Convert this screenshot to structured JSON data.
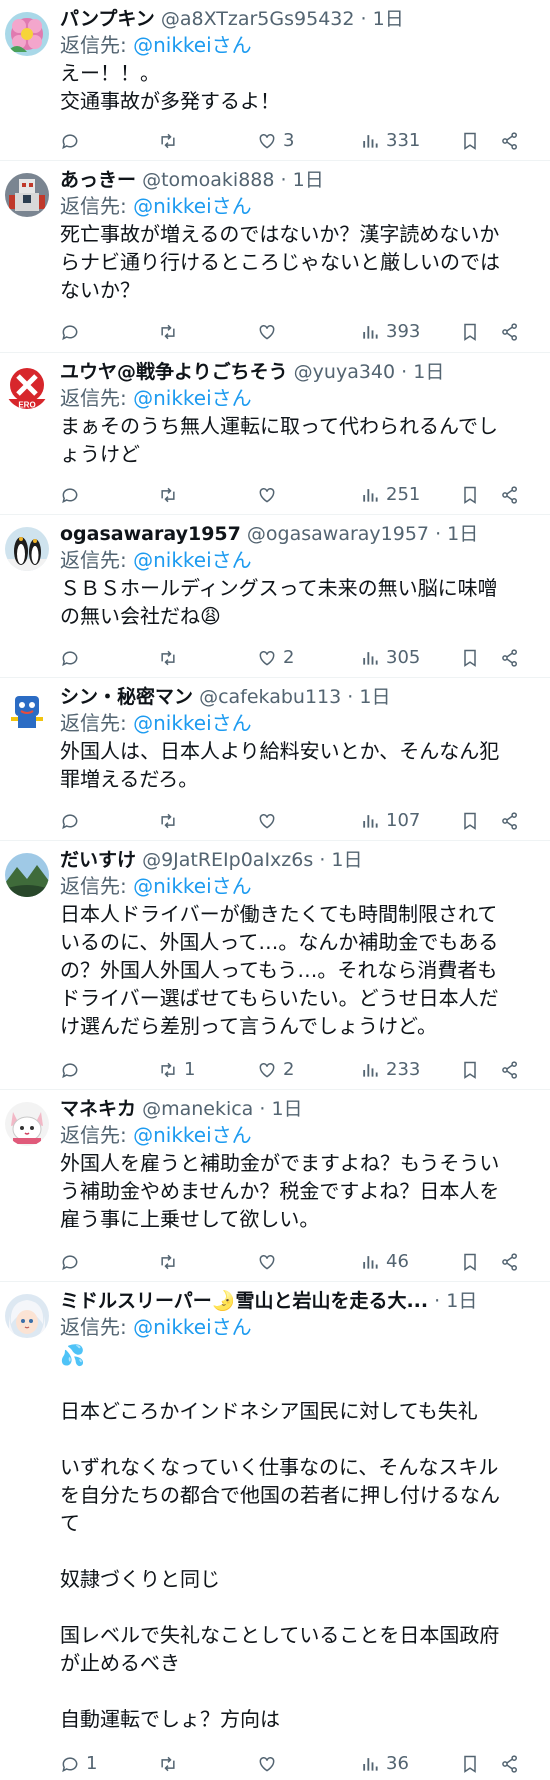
{
  "colors": {
    "text": "#0f1419",
    "muted": "#536471",
    "link": "#1d9bf0",
    "divider": "#eff3f4"
  },
  "reply_prefix": "返信先: ",
  "dot": "·",
  "tweets": [
    {
      "name": "パンプキン",
      "handle": "@a8XTzar5Gs95432",
      "time": "1日",
      "reply_to": "@nikkeiさん",
      "text": "えー！！。\n交通事故が多発するよ！",
      "reply_count": "",
      "retweet_count": "",
      "like_count": "3",
      "view_count": "331",
      "avatar": "flower-avatar"
    },
    {
      "name": "あっきー",
      "handle": "@tomoaki888",
      "time": "1日",
      "reply_to": "@nikkeiさん",
      "text": "死亡事故が増えるのではないか？漢字読めないか\nらナビ通り行けるところじゃないと厳しいのでは\nないか？",
      "reply_count": "",
      "retweet_count": "",
      "like_count": "",
      "view_count": "393",
      "avatar": "robot-avatar"
    },
    {
      "name": "ユウヤ@戦争よりごちそう",
      "handle": "@yuya340",
      "time": "1日",
      "reply_to": "@nikkeiさん",
      "text": "まぁそのうち無人運転に取って代わられるんでし\nょうけど",
      "reply_count": "",
      "retweet_count": "",
      "like_count": "",
      "view_count": "251",
      "avatar": "zero-logo-avatar"
    },
    {
      "name": "ogasawaray1957",
      "handle": "@ogasawaray1957",
      "time": "1日",
      "reply_to": "@nikkeiさん",
      "text": "ＳＢＳホールディングスって未来の無い脳に味噌\nの無い会社だね😩",
      "reply_count": "",
      "retweet_count": "",
      "like_count": "2",
      "view_count": "305",
      "avatar": "penguin-avatar"
    },
    {
      "name": "シン・秘密マン",
      "handle": "@cafekabu113",
      "time": "1日",
      "reply_to": "@nikkeiさん",
      "text": "外国人は、日本人より給料安いとか、そんなん犯\n罪増えるだろ。",
      "reply_count": "",
      "retweet_count": "",
      "like_count": "",
      "view_count": "107",
      "avatar": "mascot-avatar"
    },
    {
      "name": "だいすけ",
      "handle": "@9JatREIp0aIxz6s",
      "time": "1日",
      "reply_to": "@nikkeiさん",
      "text": "日本人ドライバーが働きたくても時間制限されて\nいるのに、外国人って…。なんか補助金でもある\nの？外国人外国人ってもう…。それなら消費者も\nドライバー選ばせてもらいたい。どうせ日本人だ\nけ選んだら差別って言うんでしょうけど。",
      "reply_count": "",
      "retweet_count": "1",
      "like_count": "2",
      "view_count": "233",
      "avatar": "landscape-avatar"
    },
    {
      "name": "マネキカ",
      "handle": "@manekica",
      "time": "1日",
      "reply_to": "@nikkeiさん",
      "text": "外国人を雇うと補助金がでますよね？もうそうい\nう補助金やめませんか？税金ですよね？日本人を\n雇う事に上乗せして欲しい。",
      "reply_count": "",
      "retweet_count": "",
      "like_count": "",
      "view_count": "46",
      "avatar": "cat-avatar"
    },
    {
      "name": "ミドルスリーパー🌛雪山と岩山を走る大...",
      "handle": "",
      "time": "1日",
      "reply_to": "@nikkeiさん",
      "text": "💦\n\n日本どころかインドネシア国民に対しても失礼\n\nいずれなくなっていく仕事なのに、そんなスキル\nを自分たちの都合で他国の若者に押し付けるなん\nて\n\n奴隷づくりと同じ\n\n国レベルで失礼なことしていることを日本国政府\nが止めるべき\n\n自動運転でしょ？方向は",
      "reply_count": "1",
      "retweet_count": "",
      "like_count": "",
      "view_count": "36",
      "avatar": "anime-avatar"
    }
  ]
}
